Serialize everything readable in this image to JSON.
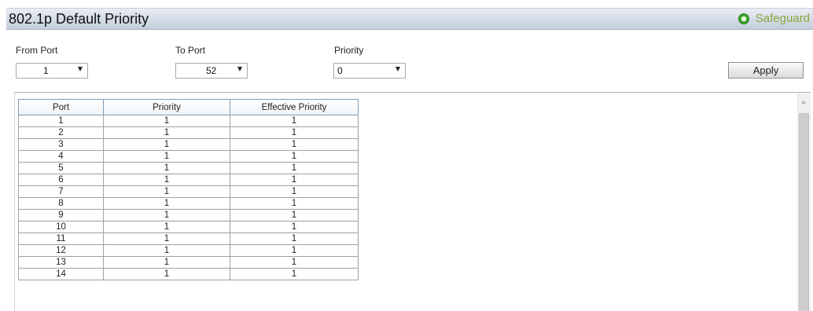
{
  "header": {
    "title": "802.1p Default Priority",
    "safeguard_label": "Safeguard",
    "safeguard_status_color": "#3aa62e"
  },
  "form": {
    "from_port": {
      "label": "From Port",
      "value": "1"
    },
    "to_port": {
      "label": "To Port",
      "value": "52"
    },
    "priority": {
      "label": "Priority",
      "value": "0"
    },
    "apply_label": "Apply"
  },
  "table": {
    "headers": [
      "Port",
      "Priority",
      "Effective Priority"
    ],
    "rows": [
      [
        "1",
        "1",
        "1"
      ],
      [
        "2",
        "1",
        "1"
      ],
      [
        "3",
        "1",
        "1"
      ],
      [
        "4",
        "1",
        "1"
      ],
      [
        "5",
        "1",
        "1"
      ],
      [
        "6",
        "1",
        "1"
      ],
      [
        "7",
        "1",
        "1"
      ],
      [
        "8",
        "1",
        "1"
      ],
      [
        "9",
        "1",
        "1"
      ],
      [
        "10",
        "1",
        "1"
      ],
      [
        "11",
        "1",
        "1"
      ],
      [
        "12",
        "1",
        "1"
      ],
      [
        "13",
        "1",
        "1"
      ],
      [
        "14",
        "1",
        "1"
      ]
    ]
  }
}
